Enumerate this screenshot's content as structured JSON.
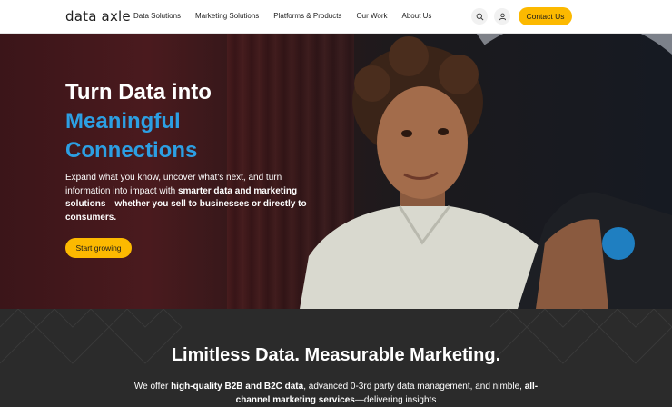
{
  "nav": {
    "logo": "data axle",
    "items": [
      "Data Solutions",
      "Marketing Solutions",
      "Platforms & Products",
      "Our Work",
      "About Us"
    ],
    "contact_label": "Contact Us",
    "icons": [
      "search-icon",
      "user-icon"
    ]
  },
  "hero": {
    "title_line1": "Turn Data into",
    "title_line2": "Meaningful",
    "title_line3": "Connections",
    "body_plain": "Expand what you know, uncover what's next, and turn information into impact with ",
    "body_bold": "smarter data and marketing solutions—whether you sell to businesses or directly to consumers.",
    "cta_label": "Start growing"
  },
  "band": {
    "title": "Limitless Data. Measurable Marketing.",
    "body_pre": "We offer ",
    "body_b1": "high-quality B2B and B2C data",
    "body_mid1": ", advanced 0-3rd party data management, and nimble, ",
    "body_b2": "all-channel marketing services",
    "body_end": "—delivering insights"
  },
  "colors": {
    "accent_yellow": "#fcb900",
    "accent_blue": "#2c9fe3",
    "dark_band": "#2b2b2b"
  }
}
